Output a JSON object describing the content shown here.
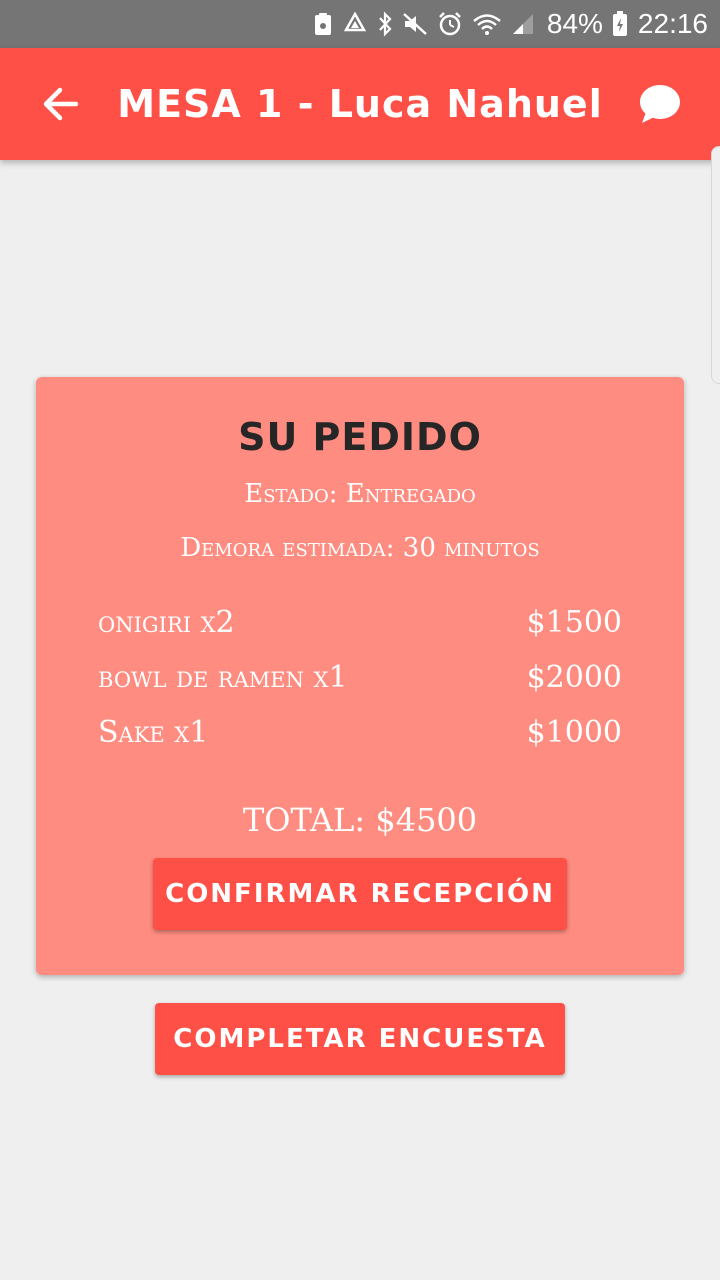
{
  "status_bar": {
    "battery": "84%",
    "time": "22:16"
  },
  "app_bar": {
    "title": "MESA 1 - Luca Nahuel"
  },
  "order": {
    "title": "SU PEDIDO",
    "status": "Estado: Entregado",
    "delay": "Demora estimada: 30 minutos",
    "items": [
      {
        "name": "onigiri x2",
        "price": "$1500"
      },
      {
        "name": "bowl de ramen x1",
        "price": "$2000"
      },
      {
        "name": "Sake x1",
        "price": "$1000"
      }
    ],
    "total": "TOTAL: $4500",
    "confirm_label": "CONFIRMAR RECEPCIÓN"
  },
  "survey_label": "COMPLETAR ENCUESTA",
  "colors": {
    "accent": "#ff5048",
    "card": "#ff8c80",
    "background": "#efefef",
    "status_bar": "#757575"
  }
}
